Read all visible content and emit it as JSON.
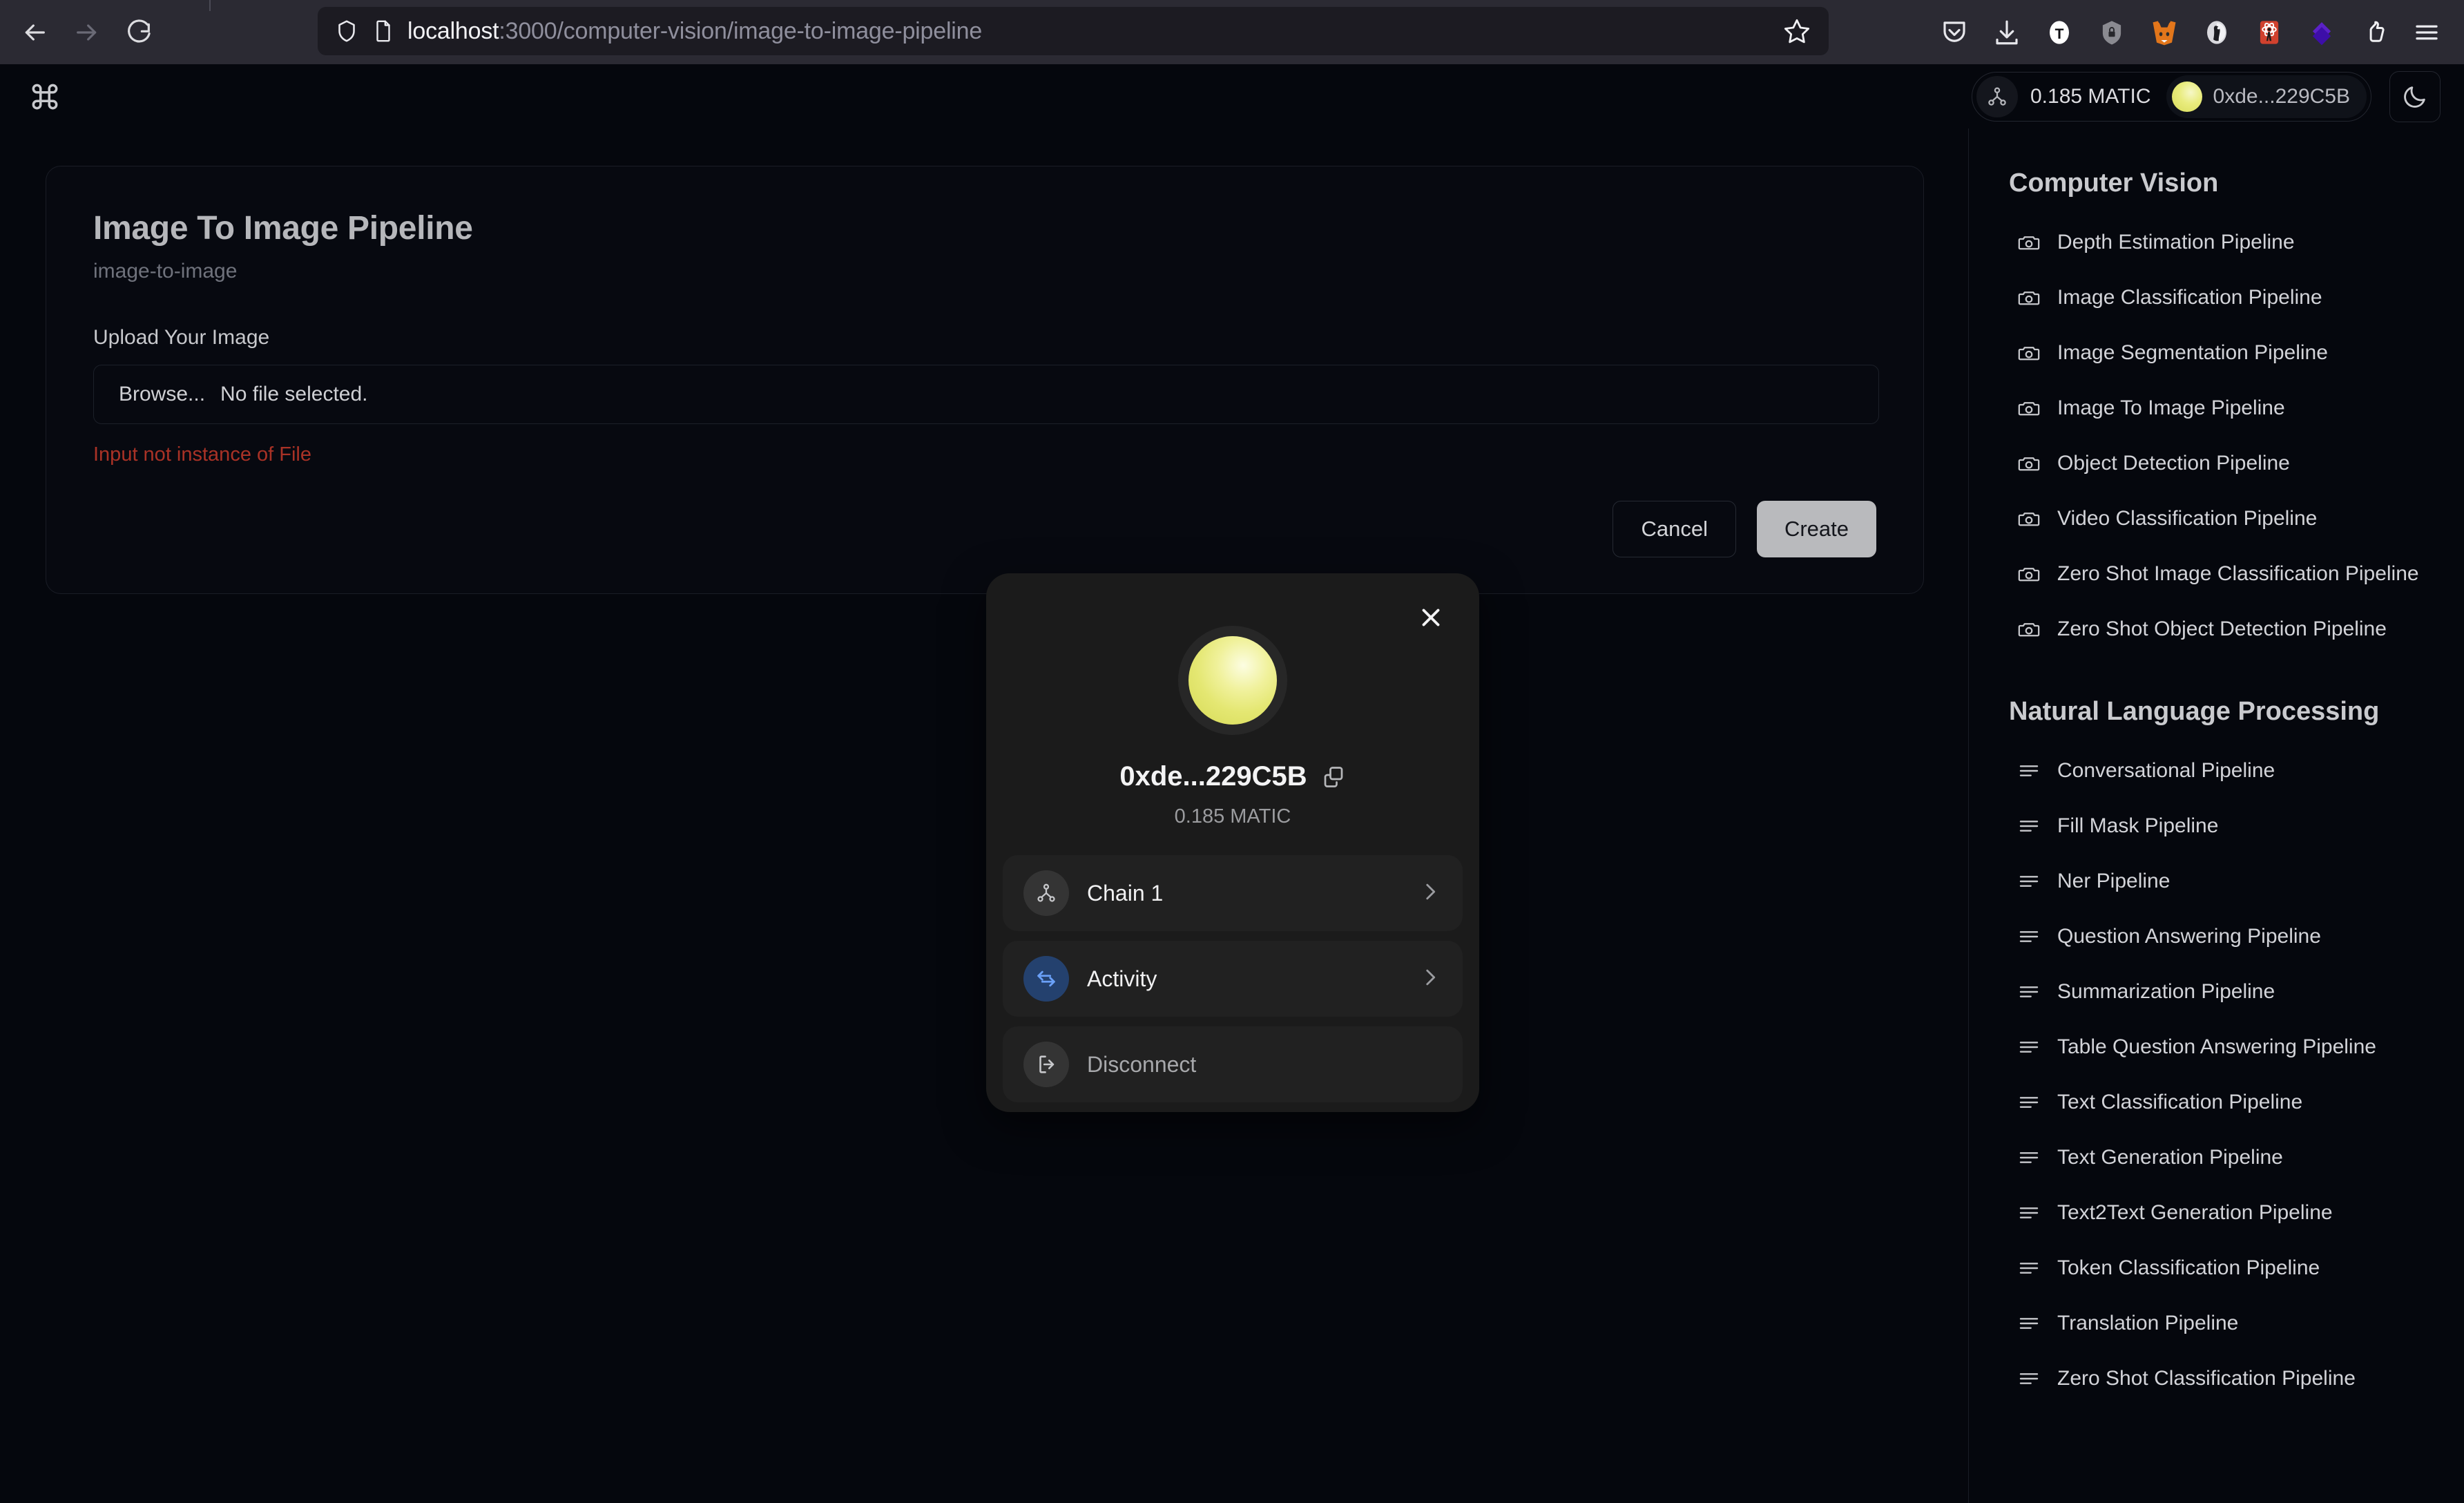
{
  "browser": {
    "nav": {
      "back": "back-arrow",
      "forward": "forward-arrow",
      "reload": "reload"
    },
    "url": {
      "host": "localhost",
      "path": ":3000/computer-vision/image-to-image-pipeline",
      "full": "localhost:3000/computer-vision/image-to-image-pipeline"
    },
    "extensions": [
      "pocket-icon",
      "download-icon",
      "tampermonkey-icon",
      "privacy-badger-icon",
      "metamask-fox-icon",
      "duckduckgo-icon",
      "react-devtools-icon",
      "diamond-wallet-icon",
      "keplr-icon",
      "hamburger-menu-icon"
    ]
  },
  "header": {
    "logo": "command-logo-icon",
    "balance": "0.185 MATIC",
    "address": "0xde...229C5B",
    "theme_toggle": "moon-icon"
  },
  "main": {
    "title": "Image To Image Pipeline",
    "subtitle": "image-to-image",
    "upload_label": "Upload Your Image",
    "browse_button": "Browse...",
    "file_status": "No file selected.",
    "error": "Input not instance of File",
    "cancel_label": "Cancel",
    "create_label": "Create",
    "accent_error_color": "#a93226",
    "create_bg_color": "#b9babd"
  },
  "modal": {
    "close": "close-icon",
    "avatar": "wallet-avatar",
    "address": "0xde...229C5B",
    "copy_icon": "copy-icon",
    "balance": "0.185 MATIC",
    "items": [
      {
        "label": "Chain 1",
        "icon": "network-chain-icon",
        "chevron": true,
        "accent": "#343434"
      },
      {
        "label": "Activity",
        "icon": "swap-arrows-icon",
        "chevron": true,
        "accent": "#24416e"
      },
      {
        "label": "Disconnect",
        "icon": "logout-icon",
        "chevron": false,
        "accent": "#343434"
      }
    ]
  },
  "sidebar": {
    "sections": [
      {
        "title": "Computer Vision",
        "icon": "camera-icon",
        "items": [
          "Depth Estimation Pipeline",
          "Image Classification Pipeline",
          "Image Segmentation Pipeline",
          "Image To Image Pipeline",
          "Object Detection Pipeline",
          "Video Classification Pipeline",
          "Zero Shot Image Classification Pipeline",
          "Zero Shot Object Detection Pipeline"
        ]
      },
      {
        "title": "Natural Language Processing",
        "icon": "text-lines-icon",
        "items": [
          "Conversational Pipeline",
          "Fill Mask Pipeline",
          "Ner Pipeline",
          "Question Answering Pipeline",
          "Summarization Pipeline",
          "Table Question Answering Pipeline",
          "Text Classification Pipeline",
          "Text Generation Pipeline",
          "Text2Text Generation Pipeline",
          "Token Classification Pipeline",
          "Translation Pipeline",
          "Zero Shot Classification Pipeline"
        ]
      }
    ]
  }
}
